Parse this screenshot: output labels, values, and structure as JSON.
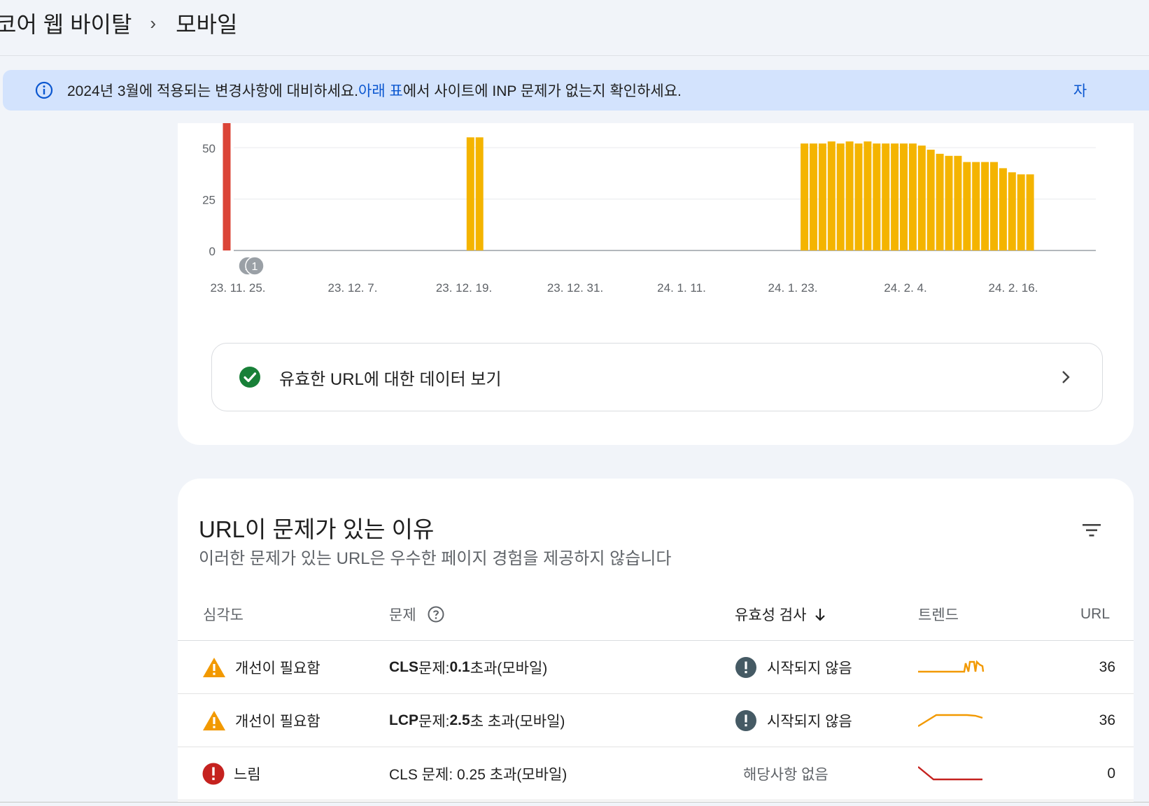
{
  "breadcrumb": {
    "parent": "코어 웹 바이탈",
    "separator": "›",
    "current": "모바일"
  },
  "banner": {
    "text_before": "2024년 3월에 적용되는 변경사항에 대비하세요. ",
    "link_text": "아래 표",
    "text_after": "에서 사이트에 INP 문제가 없는지 확인하세요.",
    "trailing": "자"
  },
  "chart_data": {
    "type": "bar",
    "y_ticks": [
      "50",
      "25",
      "0"
    ],
    "ylim": [
      0,
      60
    ],
    "x_tick_labels": [
      "23. 11. 25.",
      "23. 12. 7.",
      "23. 12. 19.",
      "23. 12. 31.",
      "24. 1. 11.",
      "24. 1. 23.",
      "24. 2. 4.",
      "24. 2. 16."
    ],
    "series": [
      {
        "color": "#db4437",
        "points": [
          {
            "day": 0,
            "value": 62
          }
        ]
      },
      {
        "color": "#f4b400",
        "points": [
          {
            "day": 27,
            "value": 55
          },
          {
            "day": 28,
            "value": 55
          },
          {
            "day": 64,
            "value": 52
          },
          {
            "day": 65,
            "value": 52
          },
          {
            "day": 66,
            "value": 52
          },
          {
            "day": 67,
            "value": 53
          },
          {
            "day": 68,
            "value": 52
          },
          {
            "day": 69,
            "value": 53
          },
          {
            "day": 70,
            "value": 52
          },
          {
            "day": 71,
            "value": 53
          },
          {
            "day": 72,
            "value": 52
          },
          {
            "day": 73,
            "value": 52
          },
          {
            "day": 74,
            "value": 52
          },
          {
            "day": 75,
            "value": 52
          },
          {
            "day": 76,
            "value": 52
          },
          {
            "day": 77,
            "value": 51
          },
          {
            "day": 78,
            "value": 49
          },
          {
            "day": 79,
            "value": 47
          },
          {
            "day": 80,
            "value": 46
          },
          {
            "day": 81,
            "value": 46
          },
          {
            "day": 82,
            "value": 43
          },
          {
            "day": 83,
            "value": 43
          },
          {
            "day": 84,
            "value": 43
          },
          {
            "day": 85,
            "value": 43
          },
          {
            "day": 86,
            "value": 40
          },
          {
            "day": 87,
            "value": 38
          },
          {
            "day": 88,
            "value": 37
          },
          {
            "day": 89,
            "value": 37
          }
        ]
      }
    ],
    "annotations": [
      {
        "day": 1,
        "label": "1"
      },
      {
        "day": 2,
        "label": "1"
      }
    ]
  },
  "valid_urls": {
    "label": "유효한 URL에 대한 데이터 보기"
  },
  "issues": {
    "title": "URL이 문제가 있는 이유",
    "subtitle": "이러한 문제가 있는 URL은 우수한 페이지 경험을 제공하지 않습니다",
    "columns": {
      "severity": "심각도",
      "issue": "문제",
      "validation": "유효성 검사",
      "trend": "트렌드",
      "urls": "URL"
    },
    "rows": [
      {
        "severity": "개선이 필요함",
        "severity_kind": "warning",
        "issue_bold": "CLS",
        "issue_mid": " 문제: ",
        "issue_bold2": "0.1",
        "issue_rest": " 초과(모바일)",
        "validation": "시작되지 않음",
        "validation_kind": "not-started",
        "count": "36",
        "trend_color": "#f29900"
      },
      {
        "severity": "개선이 필요함",
        "severity_kind": "warning",
        "issue_bold": "LCP",
        "issue_mid": " 문제: ",
        "issue_bold2": "2.5",
        "issue_rest": "초 초과(모바일)",
        "validation": "시작되지 않음",
        "validation_kind": "not-started",
        "count": "36",
        "trend_color": "#f29900"
      },
      {
        "severity": "느림",
        "severity_kind": "error",
        "issue_bold": "",
        "issue_mid": "CLS 문제: 0.25 초과(모바일)",
        "issue_bold2": "",
        "issue_rest": "",
        "validation": "해당사항 없음",
        "validation_kind": "na",
        "count": "0",
        "trend_color": "#c5221f"
      }
    ]
  }
}
